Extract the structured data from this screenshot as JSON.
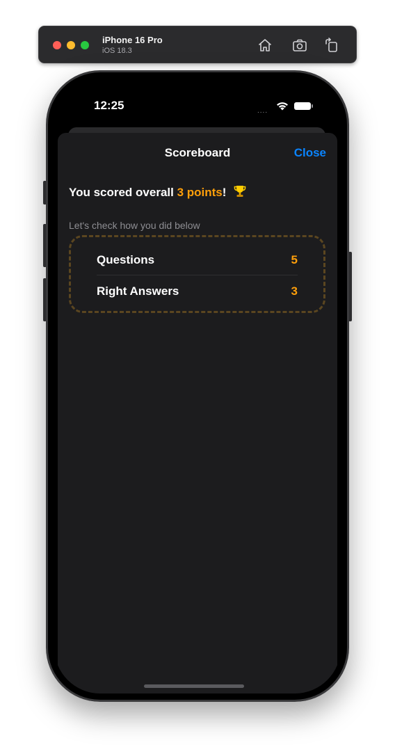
{
  "simulator": {
    "device_name": "iPhone 16 Pro",
    "os_version": "iOS 18.3",
    "icons": [
      "home-icon",
      "screenshot-icon",
      "rotate-icon"
    ]
  },
  "status_bar": {
    "time": "12:25",
    "dots": "....",
    "icons": [
      "wifi-icon",
      "battery-icon"
    ]
  },
  "sheet": {
    "title": "Scoreboard",
    "close_label": "Close",
    "score_prefix": "You scored overall ",
    "score_points": "3 points",
    "score_suffix": "!",
    "trophy_icon": "trophy-icon",
    "caption": "Let's check how you did below",
    "stats": [
      {
        "label": "Questions",
        "value": "5"
      },
      {
        "label": "Right Answers",
        "value": "3"
      }
    ]
  },
  "colors": {
    "accent_orange": "#ff9f0a",
    "link_blue": "#0a84ff",
    "sheet_background": "#1c1c1e",
    "dashed_border": "#5b4620"
  }
}
